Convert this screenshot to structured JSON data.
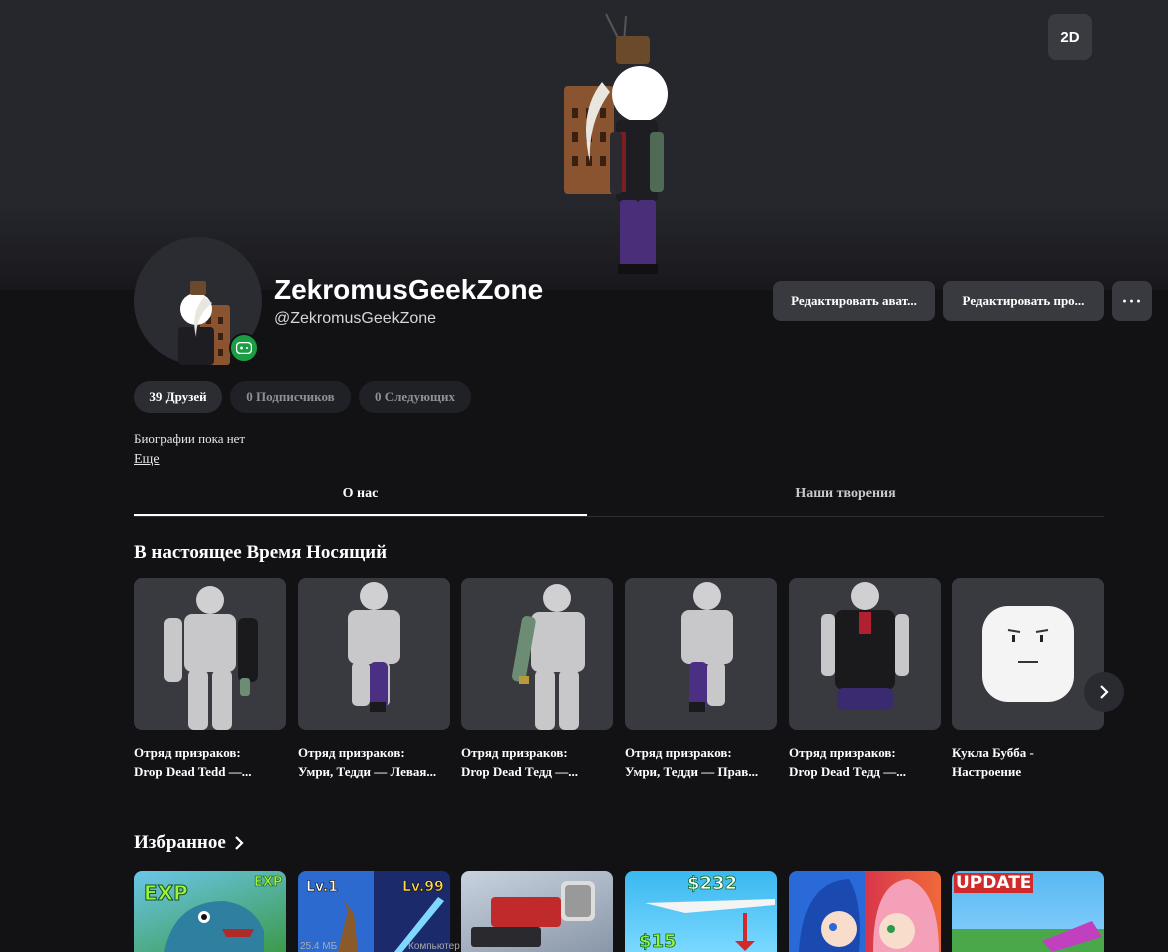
{
  "hero": {
    "view_toggle": "2D"
  },
  "profile": {
    "display_name": "ZekromusGeekZone",
    "username": "@ZekromusGeekZone"
  },
  "actions": {
    "edit_avatar": "Редактировать ават...",
    "edit_profile": "Редактировать про...",
    "more": "···"
  },
  "stats": {
    "friends": "39 Друзей",
    "followers": "0 Подписчиков",
    "following": "0 Следующих"
  },
  "bio": {
    "text": "Биографии пока нет",
    "more_link": "Еще"
  },
  "tabs": {
    "about": "О нас",
    "creations": "Наши творения"
  },
  "wearing": {
    "title": "В настоящее Время Носящий",
    "items": [
      {
        "line1": "Отряд призраков:",
        "line2": "Drop Dead Tedd —..."
      },
      {
        "line1": "Отряд призраков:",
        "line2": "Умри, Тедди — Левая..."
      },
      {
        "line1": "Отряд призраков:",
        "line2": "Drop Dead Тедд —..."
      },
      {
        "line1": "Отряд призраков:",
        "line2": "Умри, Тедди — Прав..."
      },
      {
        "line1": "Отряд призраков:",
        "line2": "Drop Dead Тедд —..."
      },
      {
        "line1": "Кукла Бубба -",
        "line2": "Настроение"
      }
    ]
  },
  "favorites": {
    "title": "Избранное",
    "game_texts": [
      "EXP",
      "EXP",
      "Lv.1",
      "Lv.99",
      "$232",
      "$15",
      "UPDATE"
    ]
  },
  "taskbar": {
    "size": "25.4 МБ",
    "computer": "Компьютер"
  },
  "colors": {
    "background": "#121215",
    "card": "#393a40",
    "online": "#1b9d44"
  }
}
